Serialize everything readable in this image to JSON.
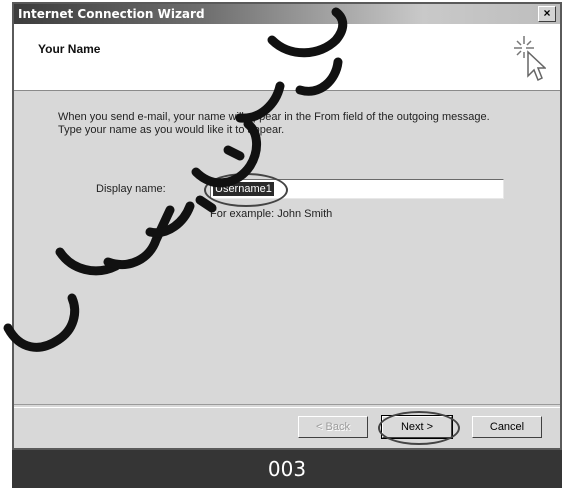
{
  "window": {
    "title": "Internet Connection Wizard",
    "close_glyph": "×"
  },
  "header": {
    "title": "Your Name",
    "icon": "wizard-cursor-icon"
  },
  "main": {
    "instructions_line1": "When you send e-mail, your name will appear in the From field of the outgoing message.",
    "instructions_line2": "Type your name as you would like it to appear.",
    "display_name_label": "Display name:",
    "display_name_value": "Username1",
    "example_text": "For example: John Smith"
  },
  "buttons": {
    "back_label": "< Back",
    "next_label": "Next >",
    "cancel_label": "Cancel"
  },
  "caption": {
    "text": "003"
  },
  "colors": {
    "title_bar_dark": "#3d3d3d",
    "dialog_gray": "#d6d6d6",
    "caption_bar": "#353535"
  }
}
